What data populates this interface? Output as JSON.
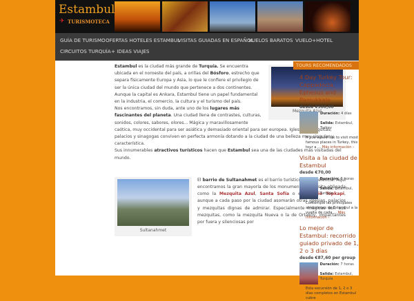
{
  "logo": {
    "title": "Estambul",
    "subtitle": "TURISMOTECA"
  },
  "nav": [
    "GUÍA DE TURISMO",
    "OFERTAS HOTELES ESTAMBUL",
    "VISITAS GUIADAS EN ESPAÑOL",
    "VUELOS BARATOS",
    "VUELO+HOTEL",
    "CIRCUITOS TURQUÍA",
    "+ IDEAS VIAJES"
  ],
  "article": {
    "p1": {
      "b1": "Estambul",
      "t1": " es la ciudad más grande de ",
      "b2": "Turquía.",
      "t2": " Se encuentra ubicada en el noroeste del país, a orillas del ",
      "b3": "Bósforo",
      "t3": ", estrecho que separa físicamente Europa y Asia, lo que le confiere el privilegio de ser la única ciudad del mundo que pertenece a dos continentes."
    },
    "p2": "Aunque la capital es Ankara, Estambul tiene un papel fundamental en la industria, el comercio, la cultura y el turismo del país.",
    "p3": {
      "t1": "Nos encontramos, sin duda, ante uno de los ",
      "b1": "lugares más fascinantes del planeta",
      "t2": ". Una ciudad llena de contrastes, culturas, sonidos, colores, sabores, olores... Mágica y maravillosamente caótica, muy occidental para ser asiática y demasiado oriental para ser europea. Iglesias, mezquitas, palacios y sinagogas conviven en perfecta armonía dotando a la ciudad de una belleza muy singular y característica."
    },
    "p4": {
      "t1": "Sus innumerables ",
      "b1": "atractivos turísticos",
      "t2": " hacen que ",
      "b2": "Estambul",
      "t3": " sea una de las ciudades más visitadas del mundo."
    },
    "fig1_caption": "Mezquita Azul",
    "fig2_caption": "Sultanahmet",
    "p5": {
      "t1": "El ",
      "b1": "barrio de Sultanahmet",
      "t2": " es el barrio turístico por excelencia. Aquí encontramos la gran mayoría de los monumentos de visita obligada como la ",
      "l1": "Mezquita Azul",
      "t3": ", ",
      "l2": "Santa Sofía",
      "t4": " o el ",
      "l3": "Palacio Topkapi",
      "t5": ", aunque a cada paso por la ciudad asomarán otras iglesias, palacios y mezquitas dignas de admirar. Especialmente mágicas son sus mezquitas, como la mezquita Nueva o la de Ortaköy, impactantes por fuera y silenciosas por"
    }
  },
  "sidebar": {
    "heading": "TOURS RECOMENDADOS",
    "dur_label": "Duración:",
    "sal_label": "Salida:",
    "more": "Más información ›",
    "tours": [
      {
        "title": "4 Day Turkey Tour: Cappadocia, Ephesus and Pamukkale",
        "price": "desde €900,00",
        "duration": "4 días",
        "departure": "Estambul, Turkey",
        "desc": "If you would like to visit most famous places in Turkey, this tour a ..."
      },
      {
        "title": "Visita a la ciudad de Estambul",
        "price": "desde €70,00",
        "duration": "8 horas",
        "departure": "Estambul, Turquía",
        "desc": "Contemple las principales atracciones de Estambul a la vuelta de cada ..."
      },
      {
        "title": "Lo mejor de Estambul: recorrido guiado privado de 1, 2 o 3 días",
        "price": "desde €87,60 per group",
        "duration": "7 horas",
        "departure": "Estambul, Turquía",
        "desc": "Esta excursión de 1, 2 o 3 días completos en Estambul cubre"
      }
    ]
  }
}
